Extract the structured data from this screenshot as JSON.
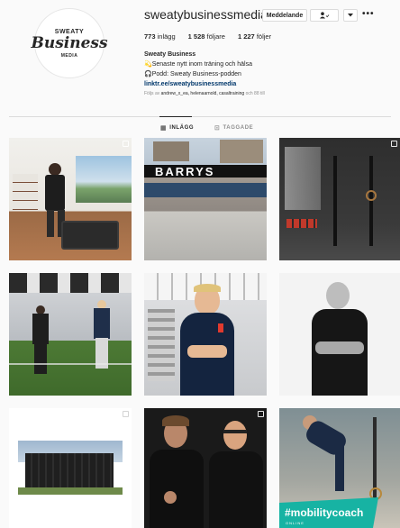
{
  "profile": {
    "avatar_line1": "SWEATY",
    "avatar_line2": "Business",
    "avatar_line3": "MEDIA",
    "username": "sweatybusinessmedia",
    "message_button": "Meddelande",
    "follow_button_icon": "person-check-icon",
    "dropdown_icon": "chevron-down-icon",
    "more_icon": "more-horizontal-icon",
    "more_label": "•••"
  },
  "stats": {
    "posts_count": "773",
    "posts_label": "inlägg",
    "followers_count": "1 528",
    "followers_label": "följare",
    "following_count": "1 227",
    "following_label": "följer"
  },
  "bio": {
    "name": "Sweaty Business",
    "line1": "💫Senaste nytt inom träning och hälsa",
    "line2": "🎧Podd: Sweaty Business-podden",
    "link": "linktr.ee/sweatybusinessmedia"
  },
  "followed_by": {
    "prefix": "Följs av",
    "names": "andrew_x_ea, helenaarnold, casaltraining",
    "suffix": "och 88 till"
  },
  "tabs": [
    {
      "label": "INLÄGG",
      "icon": "grid-icon",
      "glyph": "▦",
      "active": true
    },
    {
      "label": "TAGGADE",
      "icon": "tag-icon",
      "glyph": "⊡",
      "active": false
    }
  ],
  "posts": [
    {
      "id": "post-1",
      "description": "Man training with kettlebell in home gym",
      "multi": true
    },
    {
      "id": "post-2",
      "description": "Barry's studio facade",
      "sign": "BARRYS",
      "multi": false
    },
    {
      "id": "post-3",
      "description": "Dark gym interior with rings and kettlebells",
      "multi": true
    },
    {
      "id": "post-4",
      "description": "Two trainers on green turf in gym",
      "multi": false
    },
    {
      "id": "post-5",
      "description": "Man with arms crossed in gym",
      "multi": false
    },
    {
      "id": "post-6",
      "description": "Bald man in black shirt, black and white portrait",
      "multi": false
    },
    {
      "id": "post-7",
      "description": "Dark outdoor gym container",
      "multi": true
    },
    {
      "id": "post-8",
      "description": "Two men in black shirts",
      "multi": true
    },
    {
      "id": "post-9",
      "description": "Woman stretching",
      "overlay_text": "#mobilitycoach",
      "overlay_sub": "ONLINE",
      "multi": false
    }
  ],
  "colors": {
    "link": "#00376b",
    "muted": "#8e8e8e",
    "border": "#dbdbdb",
    "mobility_teal": "#17b3a3"
  }
}
